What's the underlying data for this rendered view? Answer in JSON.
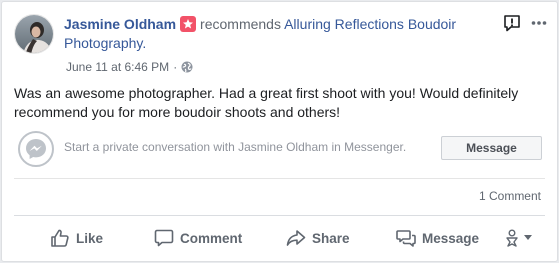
{
  "post": {
    "author": "Jasmine Oldham",
    "verb": "recommends",
    "page": "Alluring Reflections Boudoir Photography.",
    "date": "June 11 at 6:46 PM",
    "separator": "·",
    "text": "Was an awesome photographer. Had a great first shoot with you! Would definitely recommend you for more boudoir shoots and others!"
  },
  "messenger": {
    "prompt": "Start a private conversation with Jasmine Oldham in Messenger.",
    "button_label": "Message"
  },
  "stats": {
    "comments": "1 Comment"
  },
  "actions": {
    "like": "Like",
    "comment": "Comment",
    "share": "Share",
    "message": "Message"
  },
  "colors": {
    "link": "#365899",
    "badge": "#f25268",
    "muted": "#606770",
    "messenger_icon": "#bec3c9"
  },
  "icons": {
    "badge": "star-icon",
    "privacy": "globe-icon",
    "report": "exclamation-icon",
    "more": "more-dots-icon",
    "messenger": "messenger-icon",
    "like": "thumbs-up-icon",
    "comment": "comment-bubble-icon",
    "share": "share-arrow-icon",
    "message": "message-bubbles-icon",
    "audience": "audience-selector-icon"
  }
}
